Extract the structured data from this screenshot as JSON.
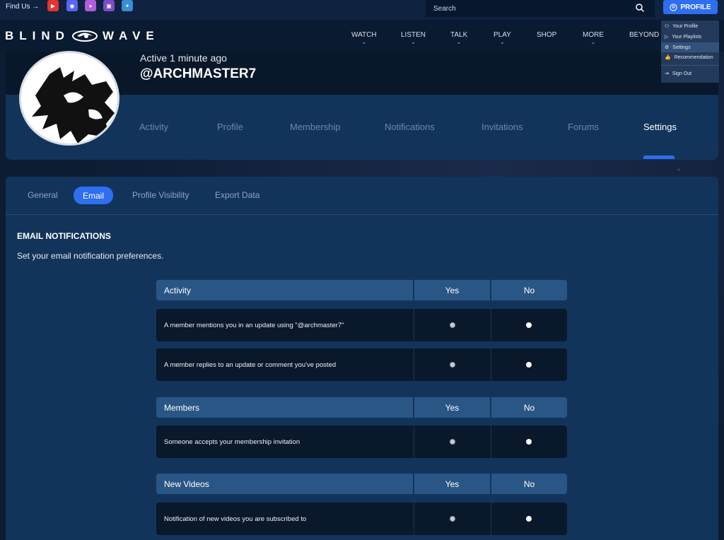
{
  "topbar": {
    "find_us": "Find Us →",
    "social_icons": [
      "youtube-icon",
      "discord-icon",
      "patreon-icon",
      "twitch-icon",
      "twitter-icon"
    ],
    "search_placeholder": "Search",
    "profile_button": "PROFILE"
  },
  "brand": {
    "logo_left": "BLIND",
    "logo_right": "WAVE"
  },
  "nav": {
    "items": [
      "WATCH",
      "LISTEN",
      "TALK",
      "PLAY",
      "SHOP",
      "MORE",
      "BEYOND"
    ]
  },
  "profile_menu": {
    "items": [
      "Your Profile",
      "Your Playlists",
      "Settings",
      "Recommendation"
    ],
    "sign_out": "Sign Out"
  },
  "user": {
    "active": "Active 1 minute ago",
    "username": "@ARCHMASTER7"
  },
  "profile_tabs": [
    "Activity",
    "Profile",
    "Membership",
    "Notifications",
    "Invitations",
    "Forums",
    "Settings"
  ],
  "settings_tabs": [
    "General",
    "Email",
    "Profile Visibility",
    "Export Data"
  ],
  "email": {
    "title": "EMAIL NOTIFICATIONS",
    "description": "Set your email notification preferences."
  },
  "groups": [
    {
      "name": "Activity",
      "yes": "Yes",
      "no": "No",
      "rows": [
        "A member mentions you in an update using \"@archmaster7\"",
        "A member replies to an update or comment you've posted"
      ]
    },
    {
      "name": "Members",
      "yes": "Yes",
      "no": "No",
      "rows": [
        "Someone accepts your membership invitation"
      ]
    },
    {
      "name": "New Videos",
      "yes": "Yes",
      "no": "No",
      "rows": [
        "Notification of new videos you are subscribed to"
      ]
    }
  ],
  "colors": {
    "accent": "#2e6ef0",
    "header_row": "#2a5686",
    "panel": "#13345a"
  }
}
